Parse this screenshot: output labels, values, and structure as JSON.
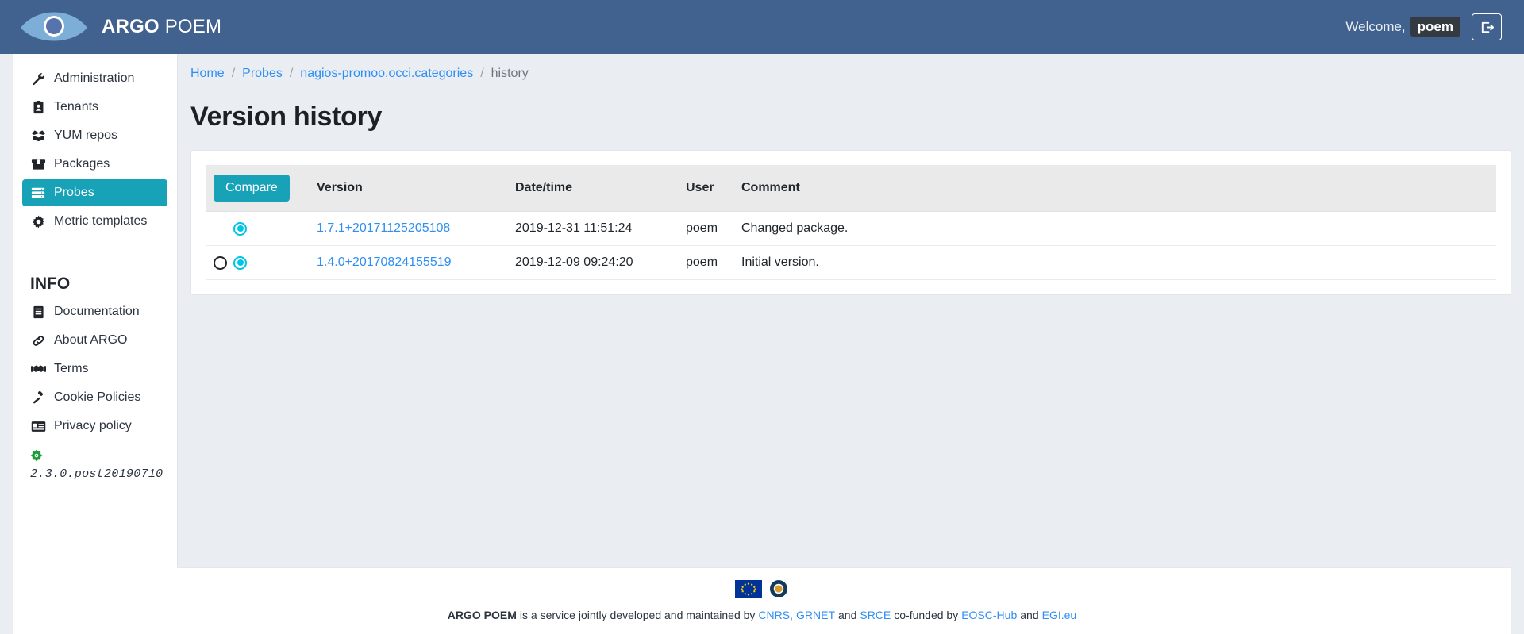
{
  "header": {
    "brand_bold": "ARGO",
    "brand_light": "POEM",
    "logo_icon": "argo-eye-logo",
    "welcome_label": "Welcome,",
    "username": "poem",
    "logout_icon": "sign-out-icon",
    "bg_color": "#41618e"
  },
  "sidebar": {
    "items": [
      {
        "label": "Administration",
        "icon": "wrench-icon",
        "active": false
      },
      {
        "label": "Tenants",
        "icon": "id-badge-icon",
        "active": false
      },
      {
        "label": "YUM repos",
        "icon": "box-open-icon",
        "active": false
      },
      {
        "label": "Packages",
        "icon": "box-icon",
        "active": false
      },
      {
        "label": "Probes",
        "icon": "server-icon",
        "active": true
      },
      {
        "label": "Metric templates",
        "icon": "cog-icon",
        "active": false
      }
    ],
    "info_title": "INFO",
    "info_items": [
      {
        "label": "Documentation",
        "icon": "book-icon"
      },
      {
        "label": "About ARGO",
        "icon": "link-icon"
      },
      {
        "label": "Terms",
        "icon": "handshake-icon"
      },
      {
        "label": "Cookie Policies",
        "icon": "gavel-icon"
      },
      {
        "label": "Privacy policy",
        "icon": "address-card-icon"
      }
    ],
    "version_icon": "crosshairs-icon",
    "version": "2.3.0.post20190710",
    "active_color": "#17a2b8"
  },
  "breadcrumb": {
    "items": [
      {
        "label": "Home",
        "link": true
      },
      {
        "label": "Probes",
        "link": true
      },
      {
        "label": "nagios-promoo.occi.categories",
        "link": true
      },
      {
        "label": "history",
        "link": false
      }
    ],
    "separator": "/"
  },
  "main": {
    "page_title": "Version history",
    "compare_button": "Compare",
    "columns": [
      "Version",
      "Date/time",
      "User",
      "Comment"
    ],
    "rows": [
      {
        "radio_left": "hidden",
        "radio_right": "checked",
        "version": "1.7.1+20171125205108",
        "datetime": "2019-12-31 11:51:24",
        "user": "poem",
        "comment": "Changed package."
      },
      {
        "radio_left": "unchecked",
        "radio_right": "checked",
        "version": "1.4.0+20170824155519",
        "datetime": "2019-12-09 09:24:20",
        "user": "poem",
        "comment": "Initial version."
      }
    ]
  },
  "footer": {
    "logos": [
      "eu-flag-logo",
      "eosc-logo"
    ],
    "brand": "ARGO POEM",
    "text_1": "is a service jointly developed and maintained by",
    "link_1": "CNRS,",
    "link_2": "GRNET",
    "text_2": "and",
    "link_3": "SRCE",
    "text_3": "co-funded by",
    "link_4": "EOSC-Hub",
    "text_4": "and",
    "link_5": "EGI.eu"
  }
}
